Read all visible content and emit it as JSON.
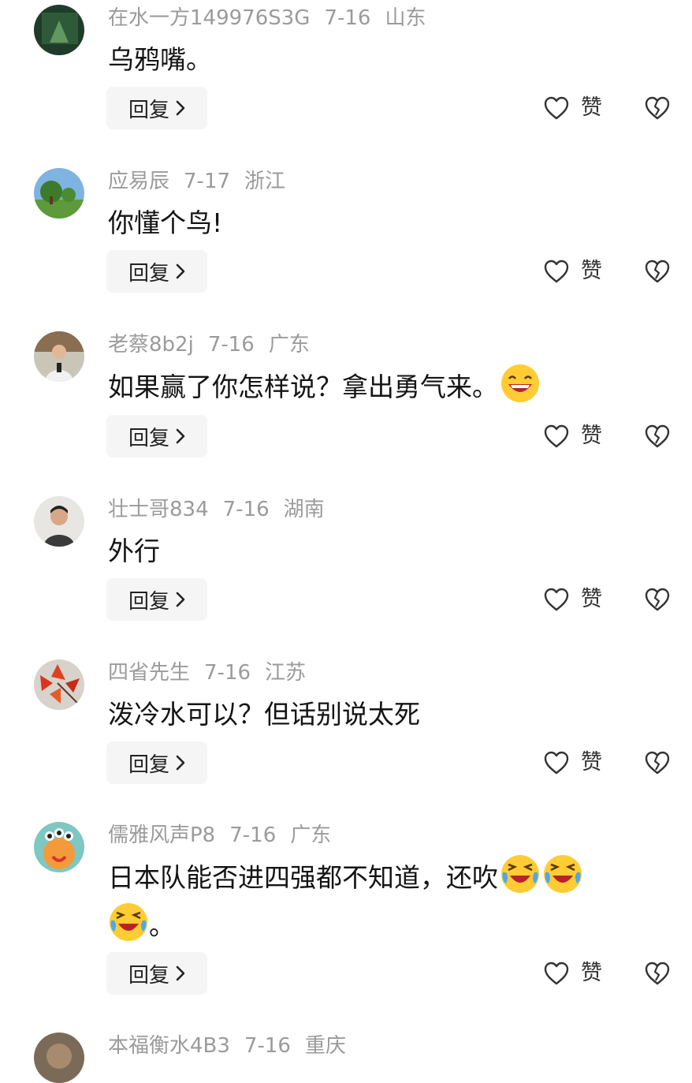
{
  "comments": [
    {
      "user": "在水一方149976S3G",
      "date": "7-16",
      "region": "山东",
      "text": "乌鸦嘴。",
      "emojis": [],
      "tail": "",
      "reply_label": "回复",
      "like_label": "赞"
    },
    {
      "user": "应易辰",
      "date": "7-17",
      "region": "浙江",
      "text": "你懂个鸟!",
      "emojis": [],
      "tail": "",
      "reply_label": "回复",
      "like_label": "赞"
    },
    {
      "user": "老蔡8b2j",
      "date": "7-16",
      "region": "广东",
      "text": "如果赢了你怎样说？拿出勇气来。",
      "emojis": [
        "grin"
      ],
      "tail": "",
      "reply_label": "回复",
      "like_label": "赞"
    },
    {
      "user": "壮士哥834",
      "date": "7-16",
      "region": "湖南",
      "text": "外行",
      "emojis": [],
      "tail": "",
      "reply_label": "回复",
      "like_label": "赞"
    },
    {
      "user": "四省先生",
      "date": "7-16",
      "region": "江苏",
      "text": "泼冷水可以？但话别说太死",
      "emojis": [],
      "tail": "",
      "reply_label": "回复",
      "like_label": "赞"
    },
    {
      "user": "儒雅风声P8",
      "date": "7-16",
      "region": "广东",
      "text": "日本队能否进四强都不知道，还吹",
      "emojis": [
        "laugh-cry",
        "laugh-cry",
        "laugh-cry"
      ],
      "tail": "。",
      "reply_label": "回复",
      "like_label": "赞"
    },
    {
      "user": "本福衡水4B3",
      "date": "7-16",
      "region": "重庆",
      "text": "",
      "emojis": [],
      "tail": "",
      "reply_label": "",
      "like_label": ""
    }
  ],
  "icons": {
    "like": "heart-outline-icon",
    "dislike": "broken-heart-icon",
    "reply_arrow": "chevron-right-icon"
  },
  "colors": {
    "meta_text": "#9b9b9b",
    "body_text": "#141414",
    "reply_bg": "#f5f5f5"
  }
}
